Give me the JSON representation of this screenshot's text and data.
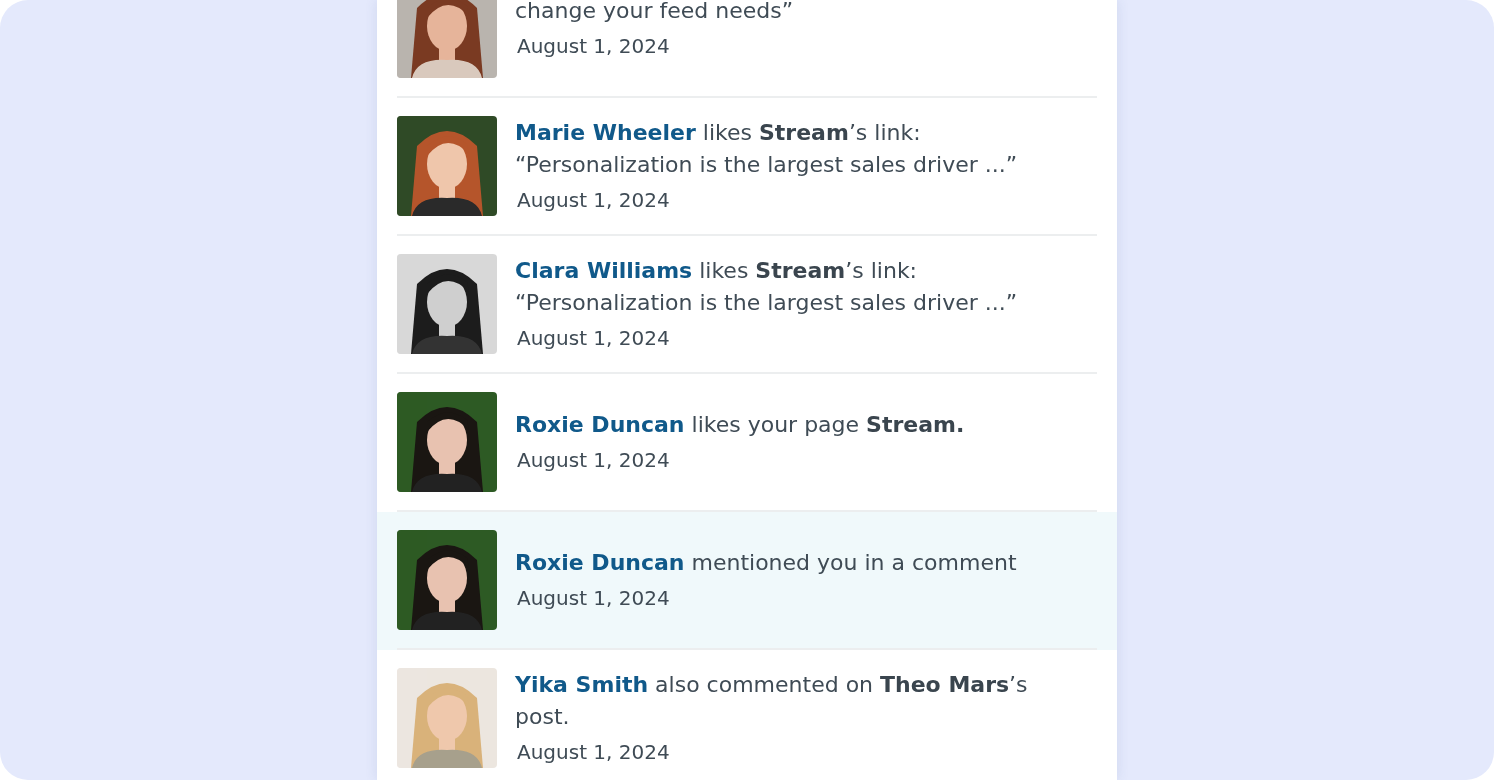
{
  "notifications": [
    {
      "message": "change your feed needs”",
      "date": "August 1, 2024",
      "unread": false
    },
    {
      "actor": "Marie Wheeler",
      "message": "likes **Stream**’s link: “Personalization is the largest sales driver ...”",
      "date": "August 1, 2024",
      "unread": false
    },
    {
      "actor": "Clara Williams",
      "message": "likes **Stream**’s link: “Personalization is the largest sales driver ...”",
      "date": "August 1, 2024",
      "unread": false
    },
    {
      "actor": "Roxie Duncan",
      "message": "likes your page **Stream.**",
      "date": "August 1, 2024",
      "unread": false
    },
    {
      "actor": "Roxie Duncan",
      "message": "mentioned you in a comment",
      "date": "August 1, 2024",
      "unread": true
    },
    {
      "actor": "Yika Smith",
      "message": "also commented on **Theo Mars**’s post.",
      "date": "August 1, 2024",
      "unread": false
    }
  ]
}
